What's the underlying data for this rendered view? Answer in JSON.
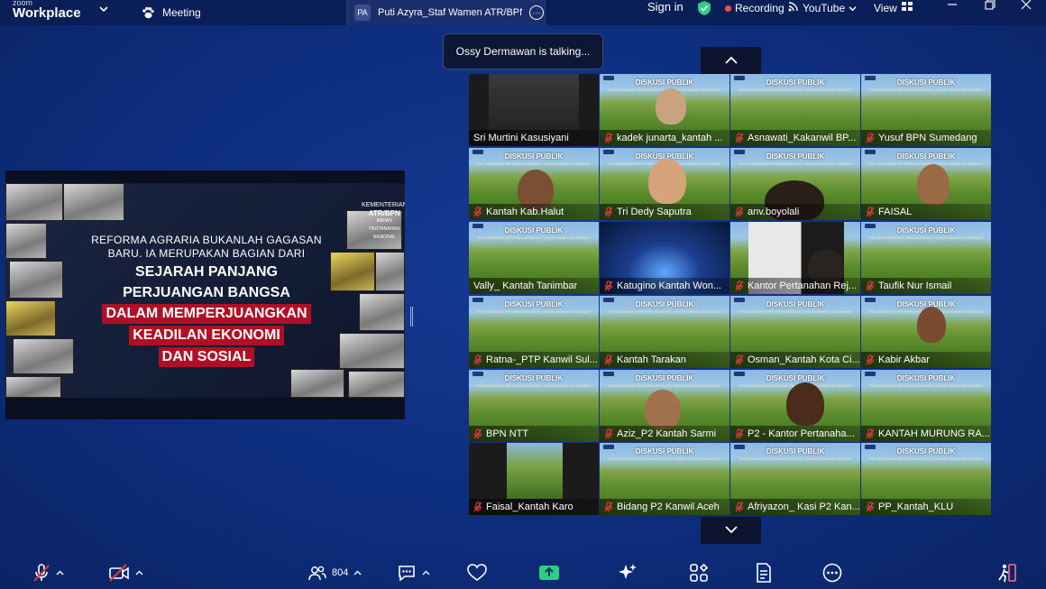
{
  "topbar": {
    "brand_small": "zoom",
    "brand_big": "Workplace",
    "meeting_label": "Meeting",
    "share_initials": "PA",
    "share_name": "Puti Azyra_Staf Wamen ATR/BPN's",
    "signin_label": "Sign in",
    "recording_label": "Recording",
    "youtube_label": "YouTube",
    "view_label": "View"
  },
  "toast": {
    "text": "Ossy Dermawan is talking..."
  },
  "slide": {
    "logo_line1": "KEMENTERIAN",
    "logo_line2": "ATR/BPN",
    "logo_line3": "BADAN PERTANAHAN NASIONAL",
    "line1": "REFORMA AGRARIA BUKANLAH GAGASAN",
    "line2": "BARU. IA MERUPAKAN BAGIAN DARI",
    "line3": "SEJARAH PANJANG",
    "line4": "PERJUANGAN BANGSA",
    "line5": "DALAM MEMPERJUANGKAN",
    "line6": "KEADILAN EKONOMI",
    "line7": "DAN SOSIAL"
  },
  "banner": {
    "title": "DISKUSI PUBLIK",
    "subtitle": "PELAKSANAAN REFORMA AGRARIA | LAHAN SAWAH DILINDUNGI"
  },
  "participants": [
    {
      "name": "Sri Murtini Kasusiyani",
      "muted": false
    },
    {
      "name": "kadek junarta_kantah ...",
      "muted": true
    },
    {
      "name": "Asnawati_Kakanwil BP...",
      "muted": true
    },
    {
      "name": "Yusuf BPN Sumedang",
      "muted": true
    },
    {
      "name": "Kantah Kab.Halut",
      "muted": true
    },
    {
      "name": "Tri Dedy Saputra",
      "muted": true
    },
    {
      "name": "anv.boyolali",
      "muted": true
    },
    {
      "name": "FAISAL",
      "muted": true
    },
    {
      "name": "Vally_ Kantah Tanimbar",
      "muted": false
    },
    {
      "name": "Katugino Kantah Won...",
      "muted": true
    },
    {
      "name": "Kantor Pertanahan Rej...",
      "muted": true
    },
    {
      "name": "Taufik Nur Ismail",
      "muted": true
    },
    {
      "name": "Ratna-_PTP Kanwil Sul...",
      "muted": true
    },
    {
      "name": "Kantah Tarakan",
      "muted": true
    },
    {
      "name": "Osman_Kantah Kota Ci...",
      "muted": true
    },
    {
      "name": "Kabir Akbar",
      "muted": true
    },
    {
      "name": "BPN NTT",
      "muted": true
    },
    {
      "name": "Aziz_P2 Kantah Sarmi",
      "muted": true
    },
    {
      "name": "P2 - Kantor Pertanaha...",
      "muted": true
    },
    {
      "name": "KANTAH MURUNG RA...",
      "muted": true
    },
    {
      "name": "Faisal_Kantah Karo",
      "muted": true
    },
    {
      "name": "Bidang P2 Kanwil Aceh",
      "muted": true
    },
    {
      "name": "Afriyazon_ Kasi P2 Kan...",
      "muted": true
    },
    {
      "name": "PP_Kantah_KLU",
      "muted": true
    }
  ],
  "toolbar": {
    "participant_count": "804"
  },
  "colors": {
    "background": "#0f2f82",
    "topbar": "#0a1f58",
    "recording_dot": "#ff4b4b",
    "mute_red": "#e53b3b",
    "slide_red": "#b10f26",
    "share_green": "#2bd17e"
  }
}
